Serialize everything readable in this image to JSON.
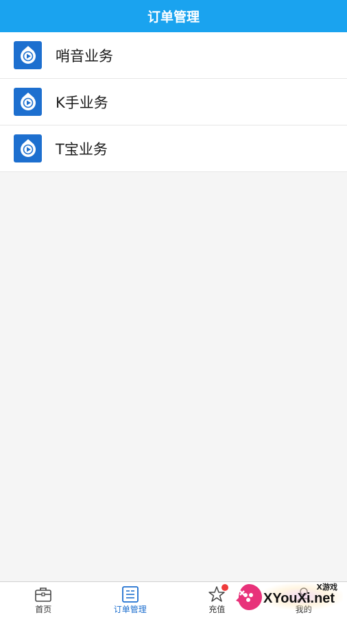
{
  "header": {
    "title": "订单管理"
  },
  "list": {
    "items": [
      {
        "label": "哨音业务",
        "icon": "logo-play-icon"
      },
      {
        "label": "K手业务",
        "icon": "logo-play-icon"
      },
      {
        "label": "T宝业务",
        "icon": "logo-play-icon"
      }
    ]
  },
  "tabbar": {
    "tabs": [
      {
        "label": "首页",
        "icon": "briefcase-icon",
        "active": false
      },
      {
        "label": "订单管理",
        "icon": "order-list-icon",
        "active": true
      },
      {
        "label": "充值",
        "icon": "star-icon",
        "active": false,
        "badge": true
      },
      {
        "label": "我的",
        "icon": "user-icon",
        "active": false
      }
    ]
  },
  "watermark": {
    "small": "X游戏",
    "main": "XYouXi.net"
  },
  "colors": {
    "header_bg": "#1aa3ef",
    "icon_bg": "#1d6fcf",
    "active_tab": "#1d6fcf",
    "badge": "#ef3b3b",
    "page_bg": "#f5f5f5"
  }
}
